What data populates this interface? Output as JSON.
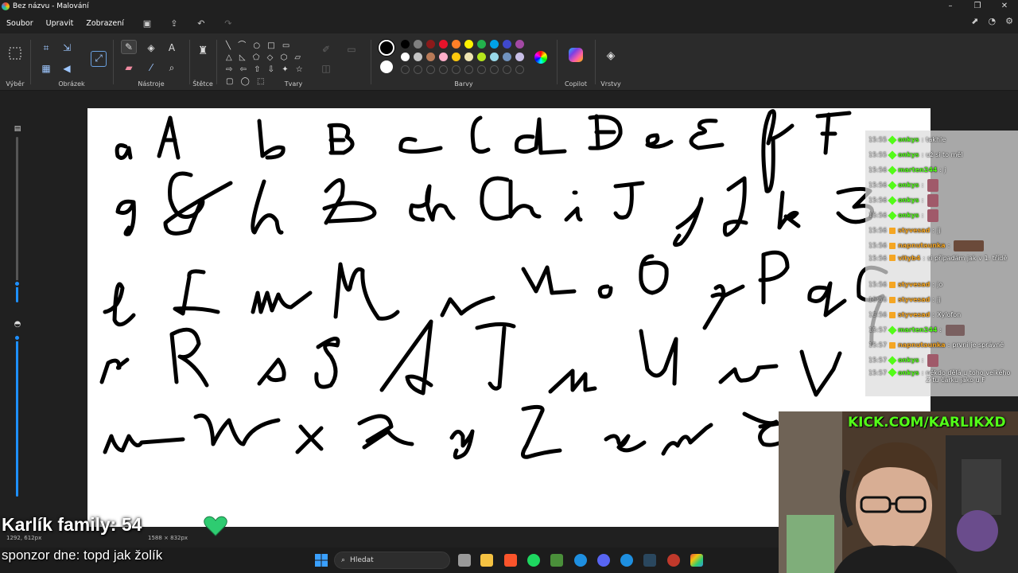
{
  "window": {
    "title": "Bez názvu - Malování",
    "minimize": "–",
    "maximize": "❐",
    "close": "✕"
  },
  "menu": {
    "items": [
      "Soubor",
      "Upravit",
      "Zobrazení"
    ]
  },
  "ribbon": {
    "groups": {
      "selection": "Výběr",
      "image": "Obrázek",
      "tools": "Nástroje",
      "brushes": "Štětce",
      "shapes": "Tvary",
      "colors": "Barvy",
      "copilot": "Copilot",
      "layers": "Vrstvy"
    },
    "shape_glyphs": "╲ ⌒ ○ □ ▭ △ ◺ ⬠ ◇ ⬡ ▱ ⇨ ⇦ ⇧ ⇩ ✦ ☆ ▢ ◯ ⬚",
    "palette_row1": [
      "#000000",
      "#7f7f7f",
      "#8b1a1a",
      "#e8132b",
      "#ff7f27",
      "#fff200",
      "#22b14c",
      "#00a2e8",
      "#3f48cc",
      "#a349a4"
    ],
    "palette_row2": [
      "#ffffff",
      "#c3c3c3",
      "#b97a57",
      "#ffaec9",
      "#ffc90e",
      "#efe4b0",
      "#b5e61d",
      "#99d9ea",
      "#7092be",
      "#c8bfe7"
    ],
    "primary_color": "#000000",
    "secondary_color": "#ffffff"
  },
  "canvas": {
    "handwriting_rows": [
      "aA bB cC dD eE fF",
      "gG h H ch Ch i I jJ kK",
      "lL mM nN oO pP qQ",
      "rR sS tT uU vV",
      "wW xX yY zZ ž Ž"
    ]
  },
  "statusbar": {
    "cursor_position": "1292, 612px",
    "canvas_size": "1588 × 832px"
  },
  "taskbar": {
    "search_label": "Hledat"
  },
  "chat": {
    "messages": [
      {
        "time": "15:55",
        "user": "onkys",
        "text": "takhle",
        "color": "g"
      },
      {
        "time": "15:55",
        "user": "onkys",
        "text": "už si to měl",
        "color": "g"
      },
      {
        "time": "15:56",
        "user": "marten244",
        "text": "j",
        "color": "g"
      },
      {
        "time": "15:56",
        "user": "onkys",
        "text": "",
        "color": "g",
        "emote": "face"
      },
      {
        "time": "15:56",
        "user": "onkys",
        "text": "",
        "color": "g",
        "emote": "face"
      },
      {
        "time": "15:56",
        "user": "onkys",
        "text": "",
        "color": "g",
        "emote": "face"
      },
      {
        "time": "15:56",
        "user": "styvesad",
        "text": "jj",
        "color": "o"
      },
      {
        "time": "15:56",
        "user": "napnutaunka",
        "text": "",
        "color": "o",
        "emote": "wide"
      },
      {
        "time": "15:56",
        "user": "vityb4",
        "text": "si připadám jak v 1. třídě",
        "color": "o"
      },
      {
        "time": "15:56",
        "user": "styvesad",
        "text": "jo",
        "color": "o"
      },
      {
        "time": "15:56",
        "user": "styvesad",
        "text": "jj",
        "color": "o"
      },
      {
        "time": "15:56",
        "user": "styvesad",
        "text": "Xylofon",
        "color": "o"
      },
      {
        "time": "15:57",
        "user": "marten244",
        "text": "",
        "color": "g",
        "emote": "mid"
      },
      {
        "time": "15:57",
        "user": "napnutaunka",
        "text": "první je správně",
        "color": "o"
      },
      {
        "time": "15:57",
        "user": "onkys",
        "text": "",
        "color": "g",
        "emote": "face"
      },
      {
        "time": "15:57",
        "user": "onkys",
        "text": "někdo dělá u toho velkého Z tu čárku jako u F",
        "color": "g"
      }
    ]
  },
  "overlay": {
    "family_counter": "Karlík family: 54",
    "sponsor": "sponzor dne: topd jak žolík",
    "kick_url": "KICK.COM/KARLIKXD"
  }
}
